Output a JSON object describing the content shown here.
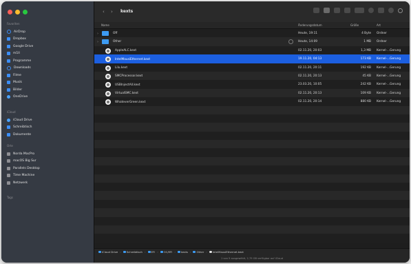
{
  "toolbar": {
    "back": "‹",
    "forward": "›",
    "title": "kexts"
  },
  "sidebar": {
    "favorites_title": "Favoriten",
    "favorites": [
      {
        "label": "AirDrop",
        "icon": "airdrop-icon"
      },
      {
        "label": "Dropbox",
        "icon": "dropbox-icon"
      },
      {
        "label": "Google Drive",
        "icon": "google-drive-icon"
      },
      {
        "label": "m1ll",
        "icon": "home-icon"
      },
      {
        "label": "Programme",
        "icon": "applications-icon"
      },
      {
        "label": "Downloads",
        "icon": "downloads-icon"
      },
      {
        "label": "Filme",
        "icon": "movies-icon"
      },
      {
        "label": "Musik",
        "icon": "music-icon"
      },
      {
        "label": "Bilder",
        "icon": "pictures-icon"
      },
      {
        "label": "OneDrive",
        "icon": "onedrive-icon"
      }
    ],
    "icloud_title": "iCloud",
    "icloud": [
      {
        "label": "iCloud Drive",
        "icon": "icloud-icon"
      },
      {
        "label": "Schreibtisch",
        "icon": "desktop-icon"
      },
      {
        "label": "Dokumente",
        "icon": "documents-icon"
      }
    ],
    "locations_title": "Orte",
    "locations": [
      {
        "label": "Norda MacPro",
        "icon": "computer-icon"
      },
      {
        "label": "macOS Big Sur",
        "icon": "disk-icon"
      },
      {
        "label": "Parallels Desktop",
        "icon": "disk-icon"
      },
      {
        "label": "Time Machine",
        "icon": "time-machine-icon"
      },
      {
        "label": "Netzwerk",
        "icon": "network-icon"
      }
    ],
    "tags_title": "Tags"
  },
  "columns": {
    "name": "Name",
    "date": "Änderungsdatum",
    "size": "Größe",
    "kind": "Art"
  },
  "files": [
    {
      "name": "Off",
      "type": "folder",
      "date": "Heute, 19:11",
      "size": "4 Byte",
      "kind": "Ordner",
      "selected": false
    },
    {
      "name": "Other",
      "type": "folder",
      "date": "Heute, 14:09",
      "size": "1 MB",
      "kind": "Ordner",
      "selected": false
    },
    {
      "name": "AppleALC.kext",
      "type": "kext",
      "date": "02.11.20, 20:03",
      "size": "1,3 MB",
      "kind": "Kernel-...Gerung",
      "selected": false
    },
    {
      "name": "IntelMausiEthernet.kext",
      "type": "kext",
      "date": "19.11.20, 04:13",
      "size": "173 KB",
      "kind": "Kernel-...Gerung",
      "selected": true
    },
    {
      "name": "Lilu.kext",
      "type": "kext",
      "date": "02.11.20, 20:11",
      "size": "192 KB",
      "kind": "Kernel-...Gerung",
      "selected": false
    },
    {
      "name": "SMCProcessor.kext",
      "type": "kext",
      "date": "02.11.20, 20:13",
      "size": "45 KB",
      "kind": "Kernel-...Gerung",
      "selected": false
    },
    {
      "name": "USBInjectAll.kext",
      "type": "kext",
      "date": "23.03.20, 10:05",
      "size": "242 KB",
      "kind": "Kernel-...Gerung",
      "selected": false
    },
    {
      "name": "VirtualSMC.kext",
      "type": "kext",
      "date": "02.11.20, 20:13",
      "size": "109 KB",
      "kind": "Kernel-...Gerung",
      "selected": false
    },
    {
      "name": "WhateverGreen.kext",
      "type": "kext",
      "date": "02.11.20, 20:14",
      "size": "880 KB",
      "kind": "Kernel-...Gerung",
      "selected": false
    }
  ],
  "pathbar": [
    {
      "label": "iCloud Drive",
      "icon": "icloud-icon"
    },
    {
      "label": "Schreibtisch",
      "icon": "folder-icon"
    },
    {
      "label": "EFI",
      "icon": "folder-icon"
    },
    {
      "label": "OC/EFI",
      "icon": "folder-icon"
    },
    {
      "label": "kexts",
      "icon": "folder-icon"
    },
    {
      "label": "Other",
      "icon": "folder-icon"
    },
    {
      "label": "IntelMausiEthernet.kext",
      "icon": "kext-icon"
    }
  ],
  "statusbar": "1 von 9 ausgewählt, 2,79 GB verfügbar auf iCloud"
}
